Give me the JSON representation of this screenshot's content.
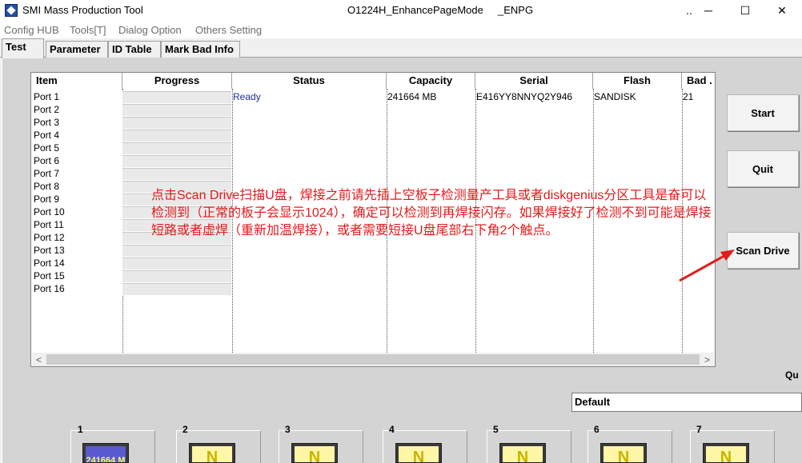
{
  "window": {
    "title": "SMI Mass Production Tool",
    "build": "O1224H_EnhancePageMode",
    "mode": "_ENPG",
    "btn_dots": "..",
    "btn_min": "─",
    "btn_max": "☐",
    "btn_close": "✕"
  },
  "menu": [
    "Config HUB",
    "Tools[T]",
    "Dialog Option",
    "Others Setting"
  ],
  "tabs": [
    "Test",
    "Parameter",
    "ID Table",
    "Mark Bad Info"
  ],
  "table": {
    "columns": [
      "Item",
      "Progress",
      "Status",
      "Capacity",
      "Serial",
      "Flash",
      "Bad ."
    ],
    "rows": [
      {
        "item": "Port 1",
        "status": "Ready",
        "capacity": "241664 MB",
        "serial": "E416YY8NNYQ2Y946",
        "flash": "SANDISK",
        "bad": "21"
      },
      {
        "item": "Port 2"
      },
      {
        "item": "Port 3"
      },
      {
        "item": "Port 4"
      },
      {
        "item": "Port 5"
      },
      {
        "item": "Port 6"
      },
      {
        "item": "Port 7"
      },
      {
        "item": "Port 8"
      },
      {
        "item": "Port 9"
      },
      {
        "item": "Port 10"
      },
      {
        "item": "Port 11"
      },
      {
        "item": "Port 12"
      },
      {
        "item": "Port 13"
      },
      {
        "item": "Port 14"
      },
      {
        "item": "Port 15"
      },
      {
        "item": "Port 16"
      }
    ]
  },
  "scroll": {
    "left": "<",
    "right": ">"
  },
  "buttons": {
    "start": "Start",
    "quit": "Quit",
    "scan": "Scan Drive"
  },
  "annotation": "点击Scan Drive扫描U盘，焊接之前请先插上空板子检测量产工具或者diskgenius分区工具是奋可以检测到（正常的板子会显示1024），确定可以检测到再焊接闪存。如果焊接好了检测不到可能是焊接短路或者虚焊（重新加温焊接），或者需要短接U盘尾部右下角2个触点。",
  "annotation_color": "#e21b1b",
  "qu_label": "Qu",
  "default_value": "Default",
  "ports": [
    {
      "num": "1",
      "label": "241664 M"
    },
    {
      "num": "2",
      "label": "N"
    },
    {
      "num": "3",
      "label": "N"
    },
    {
      "num": "4",
      "label": "N"
    },
    {
      "num": "5",
      "label": "N"
    },
    {
      "num": "6",
      "label": "N"
    },
    {
      "num": "7",
      "label": "N"
    }
  ]
}
